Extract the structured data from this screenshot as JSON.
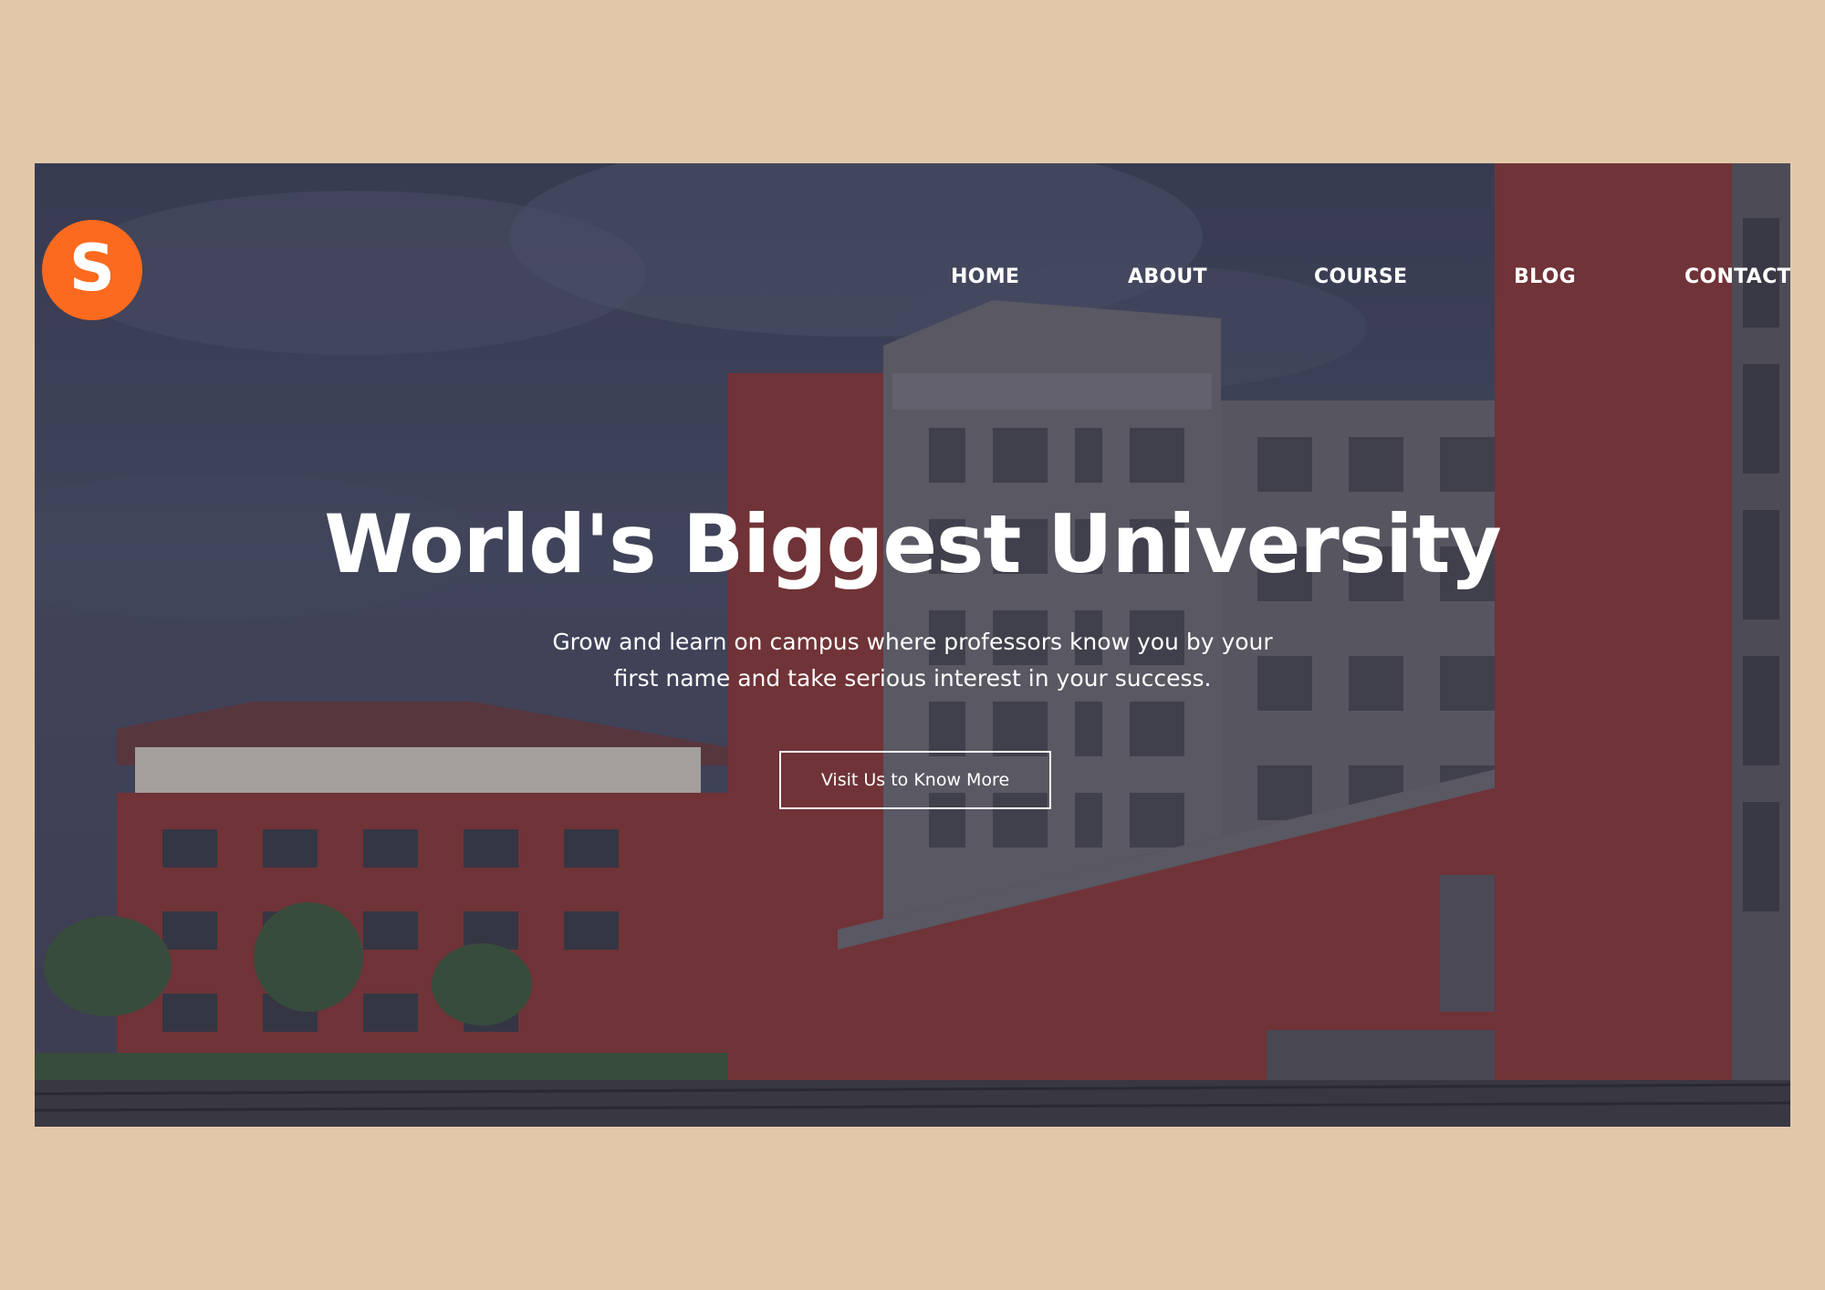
{
  "logo": {
    "letter": "S",
    "color": "#fb6a1f"
  },
  "nav": {
    "items": [
      {
        "label": "HOME"
      },
      {
        "label": "ABOUT"
      },
      {
        "label": "COURSE"
      },
      {
        "label": "BLOG"
      },
      {
        "label": "CONTACT"
      }
    ]
  },
  "hero": {
    "headline": "World's Biggest University",
    "tagline": "Grow and learn on campus where professors know you by your first name and take serious interest in your success.",
    "cta_label": "Visit Us to Know More",
    "background_image": "campus-building-photo"
  },
  "colors": {
    "page_background": "#e2c8a8",
    "accent": "#fb6a1f",
    "brick": "#8e3532",
    "text": "#ffffff"
  }
}
